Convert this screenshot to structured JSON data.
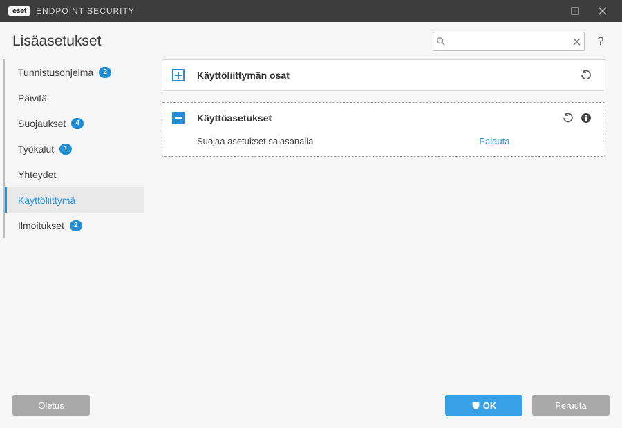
{
  "titlebar": {
    "brand_badge": "eset",
    "brand_name": "ENDPOINT SECURITY"
  },
  "header": {
    "title": "Lisäasetukset",
    "search_placeholder": ""
  },
  "sidebar": {
    "items": [
      {
        "label": "Tunnistusohjelma",
        "badge": "2"
      },
      {
        "label": "Päivitä",
        "badge": null
      },
      {
        "label": "Suojaukset",
        "badge": "4"
      },
      {
        "label": "Työkalut",
        "badge": "1"
      },
      {
        "label": "Yhteydet",
        "badge": null
      },
      {
        "label": "Käyttöliittymä",
        "badge": null
      },
      {
        "label": "Ilmoitukset",
        "badge": "2"
      }
    ]
  },
  "sections": {
    "s0": {
      "title": "Käyttöliittymän osat"
    },
    "s1": {
      "title": "Käyttöasetukset",
      "row0_label": "Suojaa asetukset salasanalla",
      "row0_link": "Palauta"
    }
  },
  "footer": {
    "default_btn": "Oletus",
    "ok_btn": "OK",
    "cancel_btn": "Peruuta"
  }
}
